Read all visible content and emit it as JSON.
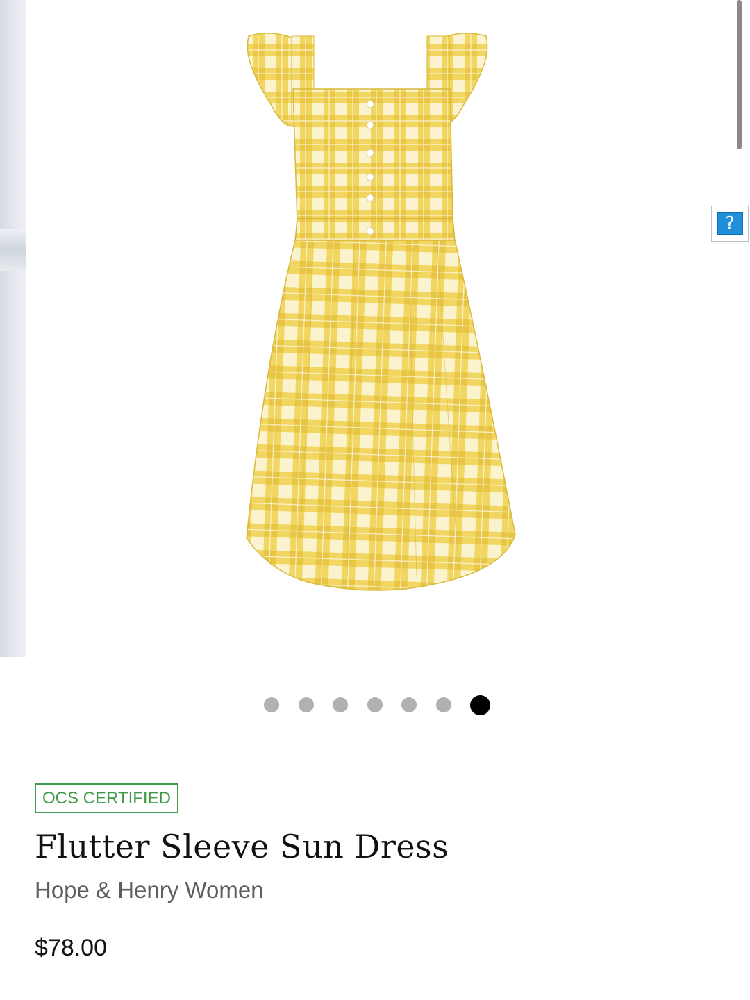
{
  "product": {
    "badge": "OCS CERTIFIED",
    "title": "Flutter Sleeve Sun Dress",
    "brand": "Hope & Henry Women",
    "price": "$78.00"
  },
  "gallery": {
    "image_alt": "Yellow gingham flutter sleeve sun dress",
    "slide_count": 7,
    "active_slide": 7
  },
  "help": {
    "label": "?"
  },
  "colors": {
    "badge_green": "#3f9a4a",
    "dot_inactive": "#b1b1b1",
    "dot_active": "#000000",
    "dress_yellow": "#f2d65a",
    "help_blue": "#1e8fd8"
  }
}
